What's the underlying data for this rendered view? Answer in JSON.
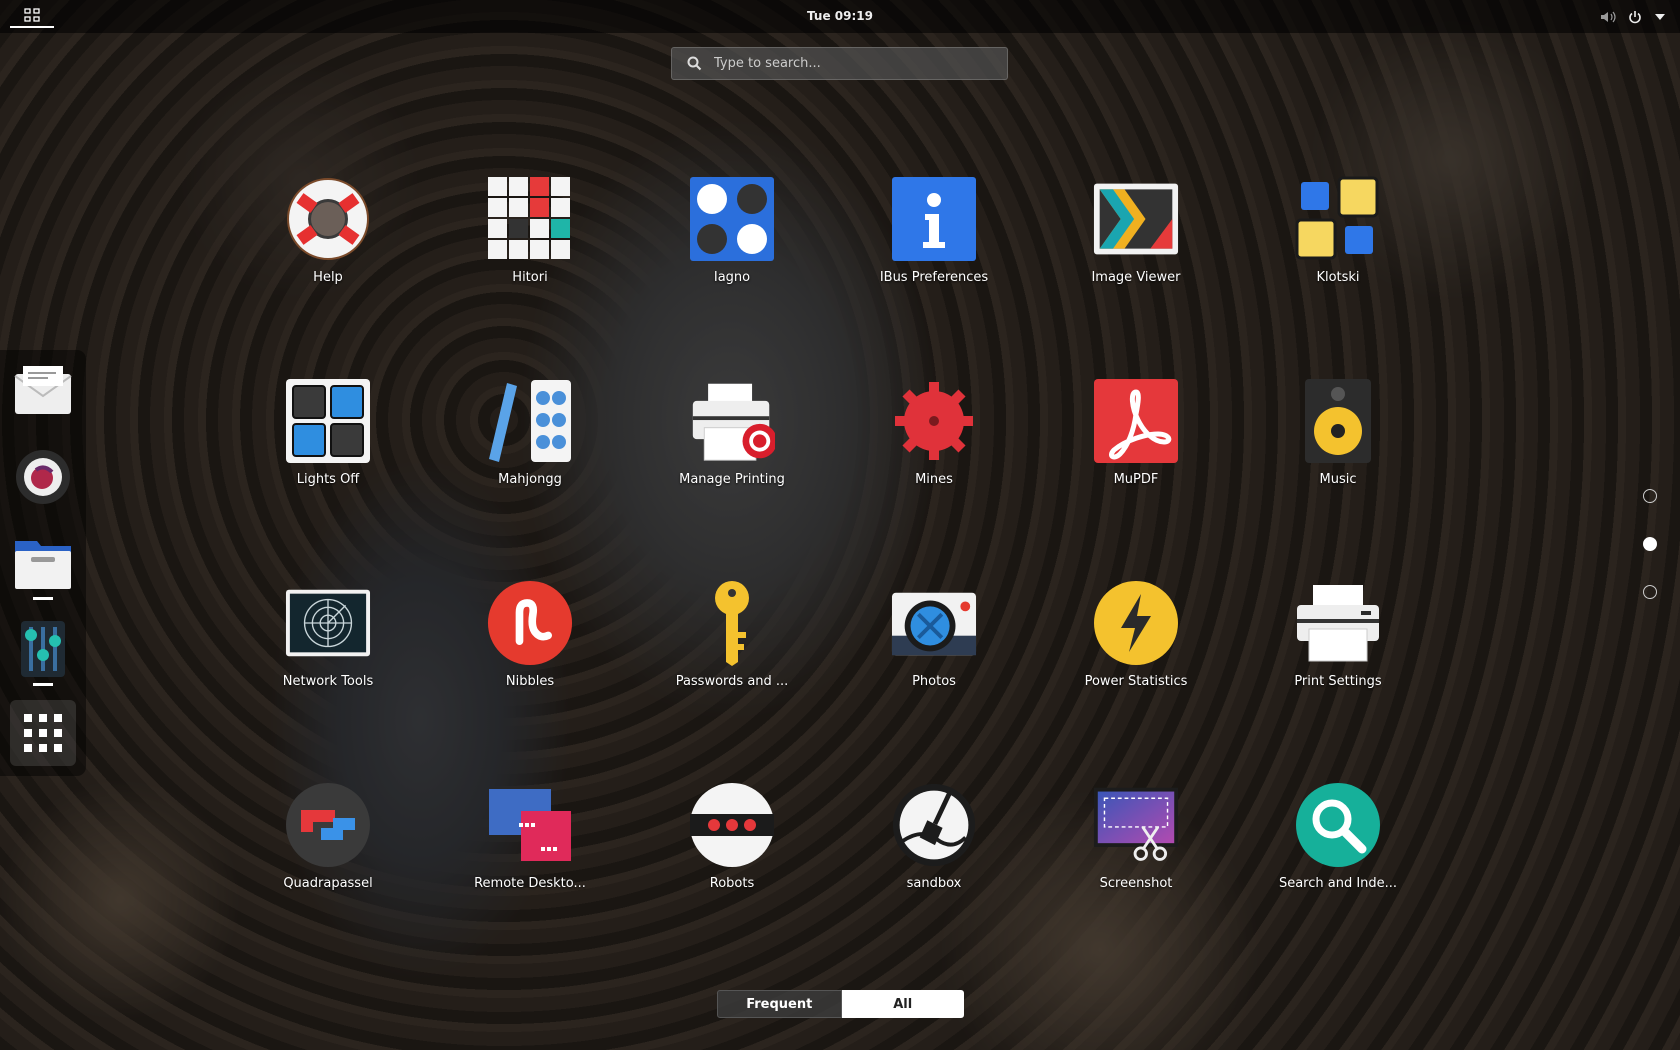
{
  "topbar": {
    "clock": "Tue 09:19"
  },
  "search": {
    "placeholder": "Type to search..."
  },
  "apps": [
    [
      "Help",
      "Hitori",
      "Iagno",
      "IBus Preferences",
      "Image Viewer",
      "Klotski"
    ],
    [
      "Lights Off",
      "Mahjongg",
      "Manage Printing",
      "Mines",
      "MuPDF",
      "Music"
    ],
    [
      "Network Tools",
      "Nibbles",
      "Passwords and ...",
      "Photos",
      "Power Statistics",
      "Print Settings"
    ],
    [
      "Quadrapassel",
      "Remote Deskto...",
      "Robots",
      "sandbox",
      "Screenshot",
      "Search and Inde..."
    ]
  ],
  "view_switch": {
    "frequent": "Frequent",
    "all": "All"
  },
  "pager": {
    "pages": 3,
    "current_page": 2
  },
  "colors": {
    "accent": "#ffffff",
    "topbar": "#000000"
  }
}
